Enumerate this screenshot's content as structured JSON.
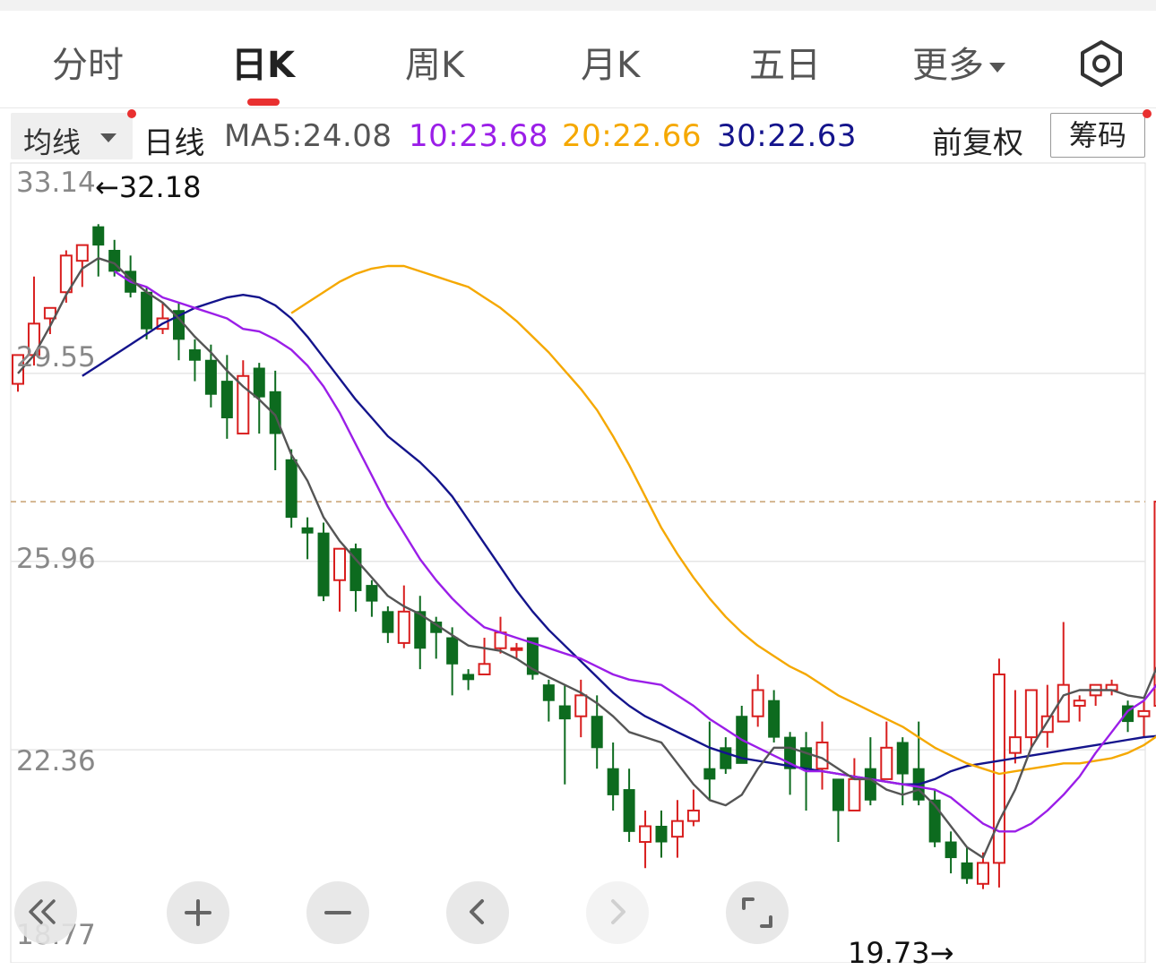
{
  "tabs": [
    {
      "label": "分时"
    },
    {
      "label": "日K"
    },
    {
      "label": "周K"
    },
    {
      "label": "月K"
    },
    {
      "label": "五日"
    },
    {
      "label": "更多"
    }
  ],
  "ma_bar": {
    "dropdown_label": "均线",
    "period_label": "日线",
    "ma5": "MA5:24.08",
    "ma10": "10:23.68",
    "ma20": "20:22.66",
    "ma30": "30:22.63",
    "adjust_label": "前复权",
    "chips_label": "筹码"
  },
  "controls": [
    "fast-backward",
    "zoom-in",
    "zoom-out",
    "prev",
    "next",
    "fullscreen"
  ],
  "colors": {
    "up": "#d81e1e",
    "down": "#0d6b1f",
    "ma5": "#555555",
    "ma10": "#9b1ee8",
    "ma20": "#f5a800",
    "ma30": "#14148c",
    "ref_line": "#c8a070"
  },
  "chart_data": {
    "type": "candlestick",
    "y_ticks": [
      "33.14",
      "29.55",
      "25.96",
      "22.36",
      "18.77"
    ],
    "ylim": [
      18.77,
      33.14
    ],
    "high_label": "←32.18",
    "low_label": "19.73→",
    "ref_price": 27.1,
    "candles": [
      [
        29.35,
        29.9,
        29.2,
        29.35
      ],
      [
        29.9,
        30.5,
        31.4,
        29.7
      ],
      [
        30.6,
        30.8,
        30.7,
        30.3
      ],
      [
        31.1,
        31.8,
        31.9,
        30.9
      ],
      [
        31.7,
        32.0,
        32.0,
        31.2
      ],
      [
        32.35,
        32.0,
        32.4,
        31.4
      ],
      [
        31.9,
        31.5,
        32.1,
        31.4
      ],
      [
        31.5,
        31.1,
        31.8,
        31.0
      ],
      [
        31.1,
        30.4,
        31.2,
        30.2
      ],
      [
        30.4,
        30.6,
        30.9,
        30.3
      ],
      [
        30.75,
        30.2,
        30.9,
        29.8
      ],
      [
        30.0,
        29.8,
        30.2,
        29.4
      ],
      [
        29.8,
        29.15,
        30.1,
        28.9
      ],
      [
        29.4,
        28.7,
        29.9,
        28.3
      ],
      [
        28.4,
        29.5,
        29.8,
        28.4
      ],
      [
        29.65,
        29.1,
        29.75,
        28.4
      ],
      [
        29.2,
        28.4,
        29.6,
        27.7
      ],
      [
        27.9,
        26.8,
        28.1,
        26.6
      ],
      [
        26.6,
        26.5,
        26.8,
        26.0
      ],
      [
        26.5,
        25.3,
        26.7,
        25.2
      ],
      [
        25.6,
        26.2,
        26.2,
        25.0
      ],
      [
        26.2,
        25.4,
        26.3,
        25.0
      ],
      [
        25.5,
        25.2,
        25.6,
        24.9
      ],
      [
        25.0,
        24.6,
        25.1,
        24.4
      ],
      [
        24.4,
        25.0,
        25.5,
        24.3
      ],
      [
        25.0,
        24.3,
        25.3,
        23.9
      ],
      [
        24.8,
        24.6,
        24.9,
        24.1
      ],
      [
        24.5,
        24.0,
        24.7,
        23.4
      ],
      [
        23.8,
        23.7,
        23.9,
        23.5
      ],
      [
        23.8,
        24.0,
        24.5,
        23.8
      ],
      [
        24.3,
        24.6,
        24.9,
        24.2
      ],
      [
        24.3,
        24.3,
        24.4,
        24.1
      ],
      [
        24.5,
        23.8,
        24.5,
        23.7
      ],
      [
        23.6,
        23.3,
        23.7,
        22.9
      ],
      [
        23.2,
        22.95,
        23.6,
        21.7
      ],
      [
        23.0,
        23.4,
        23.7,
        22.6
      ],
      [
        23.0,
        22.4,
        23.4,
        22.0
      ],
      [
        22.0,
        21.5,
        22.5,
        21.2
      ],
      [
        21.6,
        20.8,
        22.0,
        20.6
      ],
      [
        20.6,
        20.9,
        21.2,
        20.1
      ],
      [
        20.9,
        20.6,
        21.2,
        20.3
      ],
      [
        20.7,
        21.0,
        21.4,
        20.3
      ],
      [
        21.0,
        21.2,
        21.6,
        20.9
      ],
      [
        22.0,
        21.8,
        22.9,
        21.4
      ],
      [
        22.4,
        22.0,
        22.6,
        21.9
      ],
      [
        23.0,
        22.1,
        23.2,
        22.1
      ],
      [
        23.0,
        23.5,
        23.8,
        22.8
      ],
      [
        23.3,
        22.6,
        23.5,
        22.5
      ],
      [
        22.6,
        22.0,
        22.7,
        21.5
      ],
      [
        22.4,
        22.0,
        22.7,
        21.2
      ],
      [
        22.0,
        22.5,
        22.9,
        21.6
      ],
      [
        21.8,
        21.2,
        21.8,
        20.6
      ],
      [
        21.2,
        21.8,
        22.2,
        21.2
      ],
      [
        22.0,
        21.4,
        22.6,
        21.3
      ],
      [
        21.8,
        22.4,
        22.9,
        21.8
      ],
      [
        22.5,
        21.9,
        22.6,
        21.3
      ],
      [
        22.0,
        21.4,
        22.9,
        21.3
      ],
      [
        21.4,
        20.6,
        21.6,
        20.5
      ],
      [
        20.6,
        20.3,
        20.8,
        20.0
      ],
      [
        20.2,
        19.9,
        20.5,
        19.8
      ],
      [
        19.8,
        20.2,
        20.4,
        19.7
      ],
      [
        20.2,
        23.8,
        24.1,
        19.73
      ],
      [
        22.3,
        22.6,
        23.5,
        22.1
      ],
      [
        22.6,
        23.5,
        23.3,
        22.4
      ],
      [
        22.7,
        23.0,
        23.6,
        22.4
      ],
      [
        22.9,
        23.6,
        24.8,
        22.9
      ],
      [
        23.2,
        23.3,
        23.4,
        22.9
      ],
      [
        23.4,
        23.6,
        23.6,
        23.2
      ],
      [
        23.5,
        23.6,
        23.7,
        23.4
      ],
      [
        23.2,
        22.9,
        23.3,
        22.7
      ],
      [
        23.0,
        23.1,
        23.3,
        22.6
      ],
      [
        23.2,
        27.1,
        27.45,
        23.1
      ]
    ],
    "ma5": [
      29.55,
      29.9,
      30.45,
      31.05,
      31.55,
      31.75,
      31.65,
      31.35,
      31.1,
      30.9,
      30.6,
      30.25,
      29.95,
      29.6,
      29.3,
      29.05,
      28.75,
      28.0,
      27.5,
      26.8,
      26.35,
      26.0,
      25.65,
      25.3,
      25.1,
      24.95,
      24.75,
      24.55,
      24.35,
      24.3,
      24.25,
      24.1,
      23.9,
      23.75,
      23.6,
      23.45,
      23.25,
      23.0,
      22.7,
      22.6,
      22.5,
      22.1,
      21.7,
      21.4,
      21.3,
      21.5,
      22.0,
      22.4,
      22.4,
      22.3,
      22.2,
      22.0,
      21.8,
      21.8,
      21.6,
      21.5,
      21.6,
      21.3,
      20.9,
      20.5,
      20.3,
      21.0,
      21.6,
      22.4,
      22.9,
      23.4,
      23.5,
      23.5,
      23.5,
      23.4,
      23.35,
      24.08
    ],
    "ma10": [
      31.5,
      31.3,
      31.2,
      31.0,
      30.9,
      30.8,
      30.7,
      30.6,
      30.4,
      30.35,
      30.2,
      30.0,
      29.7,
      29.3,
      28.8,
      28.2,
      27.6,
      27.0,
      26.5,
      26.0,
      25.6,
      25.25,
      24.95,
      24.7,
      24.6,
      24.5,
      24.4,
      24.3,
      24.2,
      24.1,
      23.95,
      23.8,
      23.7,
      23.65,
      23.6,
      23.4,
      23.2,
      22.95,
      22.75,
      22.55,
      22.4,
      22.25,
      22.1,
      21.95,
      21.95,
      21.9,
      21.85,
      21.8,
      21.75,
      21.7,
      21.65,
      21.6,
      21.45,
      21.2,
      20.95,
      20.8,
      20.8,
      20.95,
      21.2,
      21.5,
      21.85,
      22.3,
      22.7,
      23.1,
      23.3,
      23.68
    ],
    "ma20": [
      30.7,
      30.9,
      31.1,
      31.3,
      31.45,
      31.55,
      31.6,
      31.6,
      31.5,
      31.4,
      31.3,
      31.2,
      31.0,
      30.8,
      30.55,
      30.25,
      29.95,
      29.6,
      29.25,
      28.85,
      28.35,
      27.8,
      27.2,
      26.6,
      26.1,
      25.65,
      25.25,
      24.9,
      24.6,
      24.35,
      24.15,
      23.95,
      23.8,
      23.6,
      23.4,
      23.25,
      23.1,
      22.95,
      22.8,
      22.6,
      22.4,
      22.25,
      22.1,
      22.0,
      21.9,
      21.95,
      22.0,
      22.05,
      22.1,
      22.1,
      22.15,
      22.2,
      22.3,
      22.45,
      22.66
    ],
    "ma30": [
      29.5,
      29.7,
      29.9,
      30.1,
      30.3,
      30.5,
      30.65,
      30.8,
      30.9,
      31.0,
      31.05,
      31.0,
      30.85,
      30.6,
      30.25,
      29.85,
      29.45,
      29.05,
      28.7,
      28.35,
      28.1,
      27.85,
      27.55,
      27.2,
      26.75,
      26.3,
      25.85,
      25.4,
      25.0,
      24.65,
      24.35,
      24.05,
      23.75,
      23.45,
      23.2,
      23.0,
      22.85,
      22.7,
      22.55,
      22.4,
      22.3,
      22.2,
      22.15,
      22.1,
      22.05,
      22.0,
      21.95,
      21.9,
      21.85,
      21.8,
      21.75,
      21.7,
      21.7,
      21.8,
      21.95,
      22.05,
      22.1,
      22.15,
      22.2,
      22.25,
      22.3,
      22.35,
      22.4,
      22.45,
      22.5,
      22.55,
      22.6,
      22.63
    ]
  }
}
